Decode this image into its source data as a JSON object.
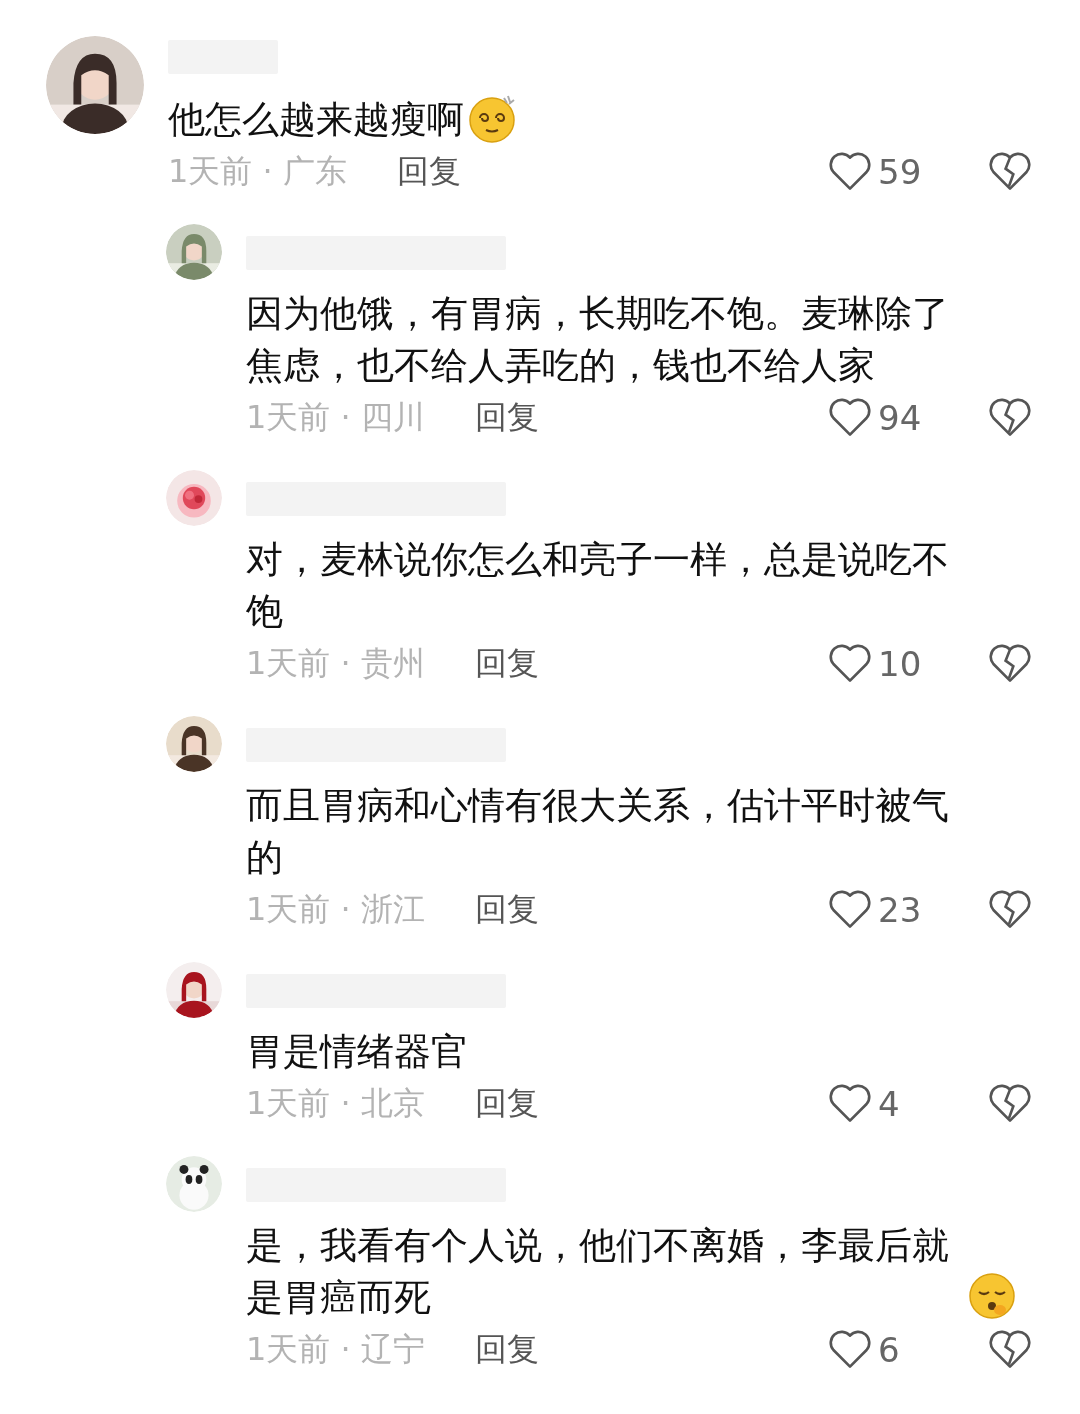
{
  "comments": [
    {
      "text": "他怎么越来越瘦啊",
      "kind": "dizzy",
      "meta": "1天前 · 广东",
      "reply_label": "回复",
      "likes": "59",
      "children": [
        {
          "text": "因为他饿，有胃病，长期吃不饱。麦琳除了焦虑，也不给人弄吃的，钱也不给人家",
          "kind": "plain",
          "meta": "1天前 · 四川",
          "reply_label": "回复",
          "likes": "94"
        },
        {
          "text": "对，麦林说你怎么和亮子一样，总是说吃不饱",
          "kind": "plain",
          "meta": "1天前 · 贵州",
          "reply_label": "回复",
          "likes": "10"
        },
        {
          "text": "而且胃病和心情有很大关系，估计平时被气的",
          "kind": "plain",
          "meta": "1天前 · 浙江",
          "reply_label": "回复",
          "likes": "23"
        },
        {
          "text": "胃是情绪器官",
          "kind": "plain",
          "meta": "1天前 · 北京",
          "reply_label": "回复",
          "likes": "4"
        },
        {
          "text": "是，我看有个人说，他们不离婚，李最后就是胃癌而死",
          "kind": "hushed",
          "meta": "1天前 · 辽宁",
          "reply_label": "回复",
          "likes": "6"
        }
      ]
    }
  ]
}
